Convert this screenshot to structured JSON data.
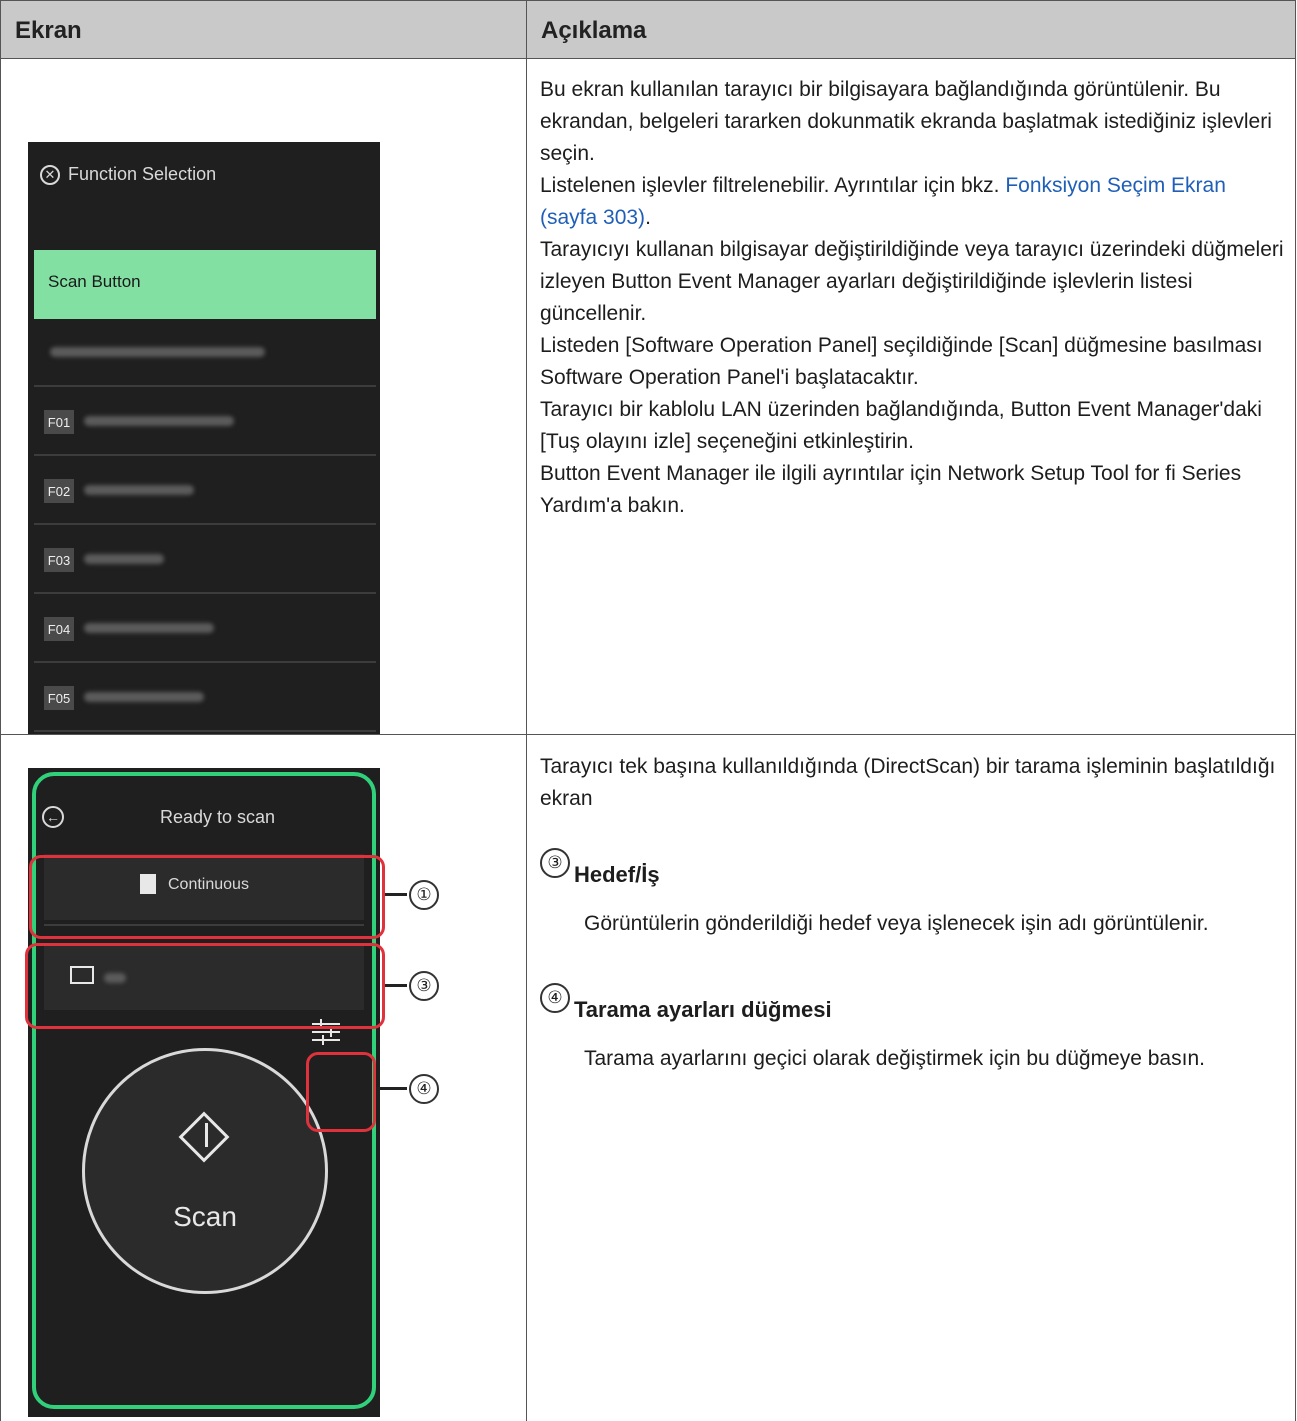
{
  "table": {
    "headers": [
      "Ekran",
      "Açıklama"
    ]
  },
  "row1": {
    "panel": {
      "title": "Function Selection",
      "selected_item": "Scan Button",
      "items": [
        {
          "code": ""
        },
        {
          "code": "F01"
        },
        {
          "code": "F02"
        },
        {
          "code": "F03"
        },
        {
          "code": "F04"
        },
        {
          "code": "F05"
        }
      ]
    },
    "desc": {
      "p1": "Bu ekran kullanılan tarayıcı bir bilgisayara bağlandığında görüntülenir. Bu ekrandan, belgeleri tararken dokunmatik ekranda başlatmak istediğiniz işlevleri seçin.",
      "p2_before": "Listelenen işlevler filtrelenebilir. Ayrıntılar için bkz. ",
      "p2_link": "Fonksiyon Seçim Ekran (sayfa 303)",
      "p2_after": ".",
      "p3": "Tarayıcıyı kullanan bilgisayar değiştirildiğinde veya tarayıcı üzerindeki düğmeleri izleyen Button Event Manager ayarları değiştirildiğinde işlevlerin listesi güncellenir.",
      "p4": "Listeden [Software Operation Panel] seçildiğinde [Scan] düğmesine basılması Software Operation Panel'i başlatacaktır.",
      "p5": "Tarayıcı bir kablolu LAN üzerinden bağlandığında, Button Event Manager'daki [Tuş olayını izle] seçeneğini etkinleştirin.",
      "p6": "Button Event Manager ile ilgili ayrıntılar için Network Setup Tool for fi Series Yardım'a bakın."
    }
  },
  "row2": {
    "panel": {
      "title": "Ready to scan",
      "continuous_label": "Continuous",
      "scan_label": "Scan",
      "callouts": [
        "①",
        "③",
        "④"
      ]
    },
    "desc": {
      "intro": "Tarayıcı tek başına kullanıldığında (DirectScan) bir tarama işleminin başlatıldığı ekran",
      "item3_num": "③",
      "item3_title": "Hedef/İş",
      "item3_text": "Görüntülerin gönderildiği hedef veya işlenecek işin adı görüntülenir.",
      "item4_num": "④",
      "item4_title": "Tarama ayarları düğmesi",
      "item4_text": "Tarama ayarlarını geçici olarak değiştirmek için bu düğmeye basın."
    }
  }
}
